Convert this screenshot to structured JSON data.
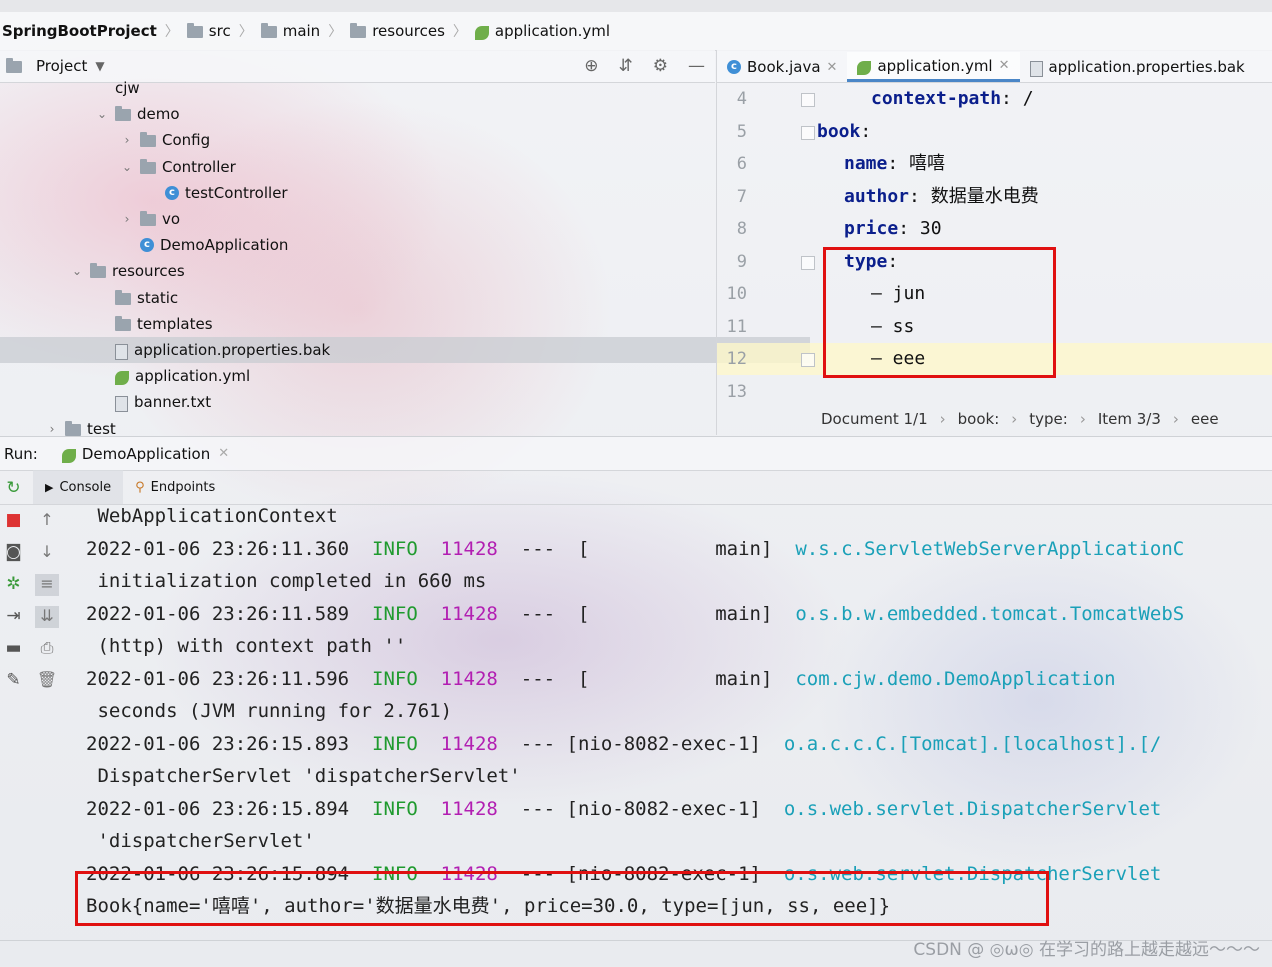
{
  "breadcrumb": {
    "project": "SpringBootProject",
    "items": [
      "src",
      "main",
      "resources",
      "application.yml"
    ]
  },
  "project_panel": {
    "title": "Project",
    "tree": [
      {
        "label": "cjw",
        "indent": 1,
        "icon": "none"
      },
      {
        "label": "demo",
        "indent": 1,
        "icon": "folder",
        "arrow": "down"
      },
      {
        "label": "Config",
        "indent": 2,
        "icon": "folder",
        "arrow": "right"
      },
      {
        "label": "Controller",
        "indent": 2,
        "icon": "folder",
        "arrow": "down"
      },
      {
        "label": "testController",
        "indent": 3,
        "icon": "class"
      },
      {
        "label": "vo",
        "indent": 2,
        "icon": "folder",
        "arrow": "right"
      },
      {
        "label": "DemoApplication",
        "indent": 2,
        "icon": "class"
      },
      {
        "label": "resources",
        "indent": 0,
        "icon": "folder",
        "arrow": "down"
      },
      {
        "label": "static",
        "indent": 1,
        "icon": "folder"
      },
      {
        "label": "templates",
        "indent": 1,
        "icon": "folder"
      },
      {
        "label": "application.properties.bak",
        "indent": 1,
        "icon": "file",
        "selected": true
      },
      {
        "label": "application.yml",
        "indent": 1,
        "icon": "leaf"
      },
      {
        "label": "banner.txt",
        "indent": 1,
        "icon": "file"
      },
      {
        "label": "test",
        "indent": -1,
        "icon": "folder",
        "arrow": "right"
      }
    ]
  },
  "editor": {
    "tabs": [
      {
        "label": "Book.java",
        "icon": "class"
      },
      {
        "label": "application.yml",
        "icon": "leaf",
        "active": true
      },
      {
        "label": "application.properties.bak",
        "icon": "file"
      }
    ],
    "lines": [
      {
        "num": "4",
        "indent": 2,
        "key": "context-path",
        "value": "/"
      },
      {
        "num": "5",
        "indent": 0,
        "key": "book",
        "value": ""
      },
      {
        "num": "6",
        "indent": 1,
        "key": "name",
        "value": "嘻嘻"
      },
      {
        "num": "7",
        "indent": 1,
        "key": "author",
        "value": "数据量水电费"
      },
      {
        "num": "8",
        "indent": 1,
        "key": "price",
        "value": "30"
      },
      {
        "num": "9",
        "indent": 1,
        "key": "type",
        "value": ""
      },
      {
        "num": "10",
        "indent": 2,
        "key": "",
        "value": "– jun"
      },
      {
        "num": "11",
        "indent": 2,
        "key": "",
        "value": "– ss"
      },
      {
        "num": "12",
        "indent": 2,
        "key": "",
        "value": "– eee"
      },
      {
        "num": "13",
        "indent": 0,
        "key": "",
        "value": ""
      }
    ],
    "status": [
      "Document 1/1",
      "book:",
      "type:",
      "Item 3/3",
      "eee"
    ]
  },
  "run": {
    "label": "Run:",
    "config": "DemoApplication",
    "tabs": [
      "Console",
      "Endpoints"
    ]
  },
  "console_lines": [
    {
      "text": " WebApplicationContext"
    },
    {
      "ts": "2022-01-06 23:26:11.360",
      "level": "INFO",
      "pid": "11428",
      "thread": "---  [           main]",
      "logger": "w.s.c.ServletWebServerApplicationC"
    },
    {
      "text": " initialization completed in 660 ms"
    },
    {
      "ts": "2022-01-06 23:26:11.589",
      "level": "INFO",
      "pid": "11428",
      "thread": "---  [           main]",
      "logger": "o.s.b.w.embedded.tomcat.TomcatWebS"
    },
    {
      "text": " (http) with context path ''"
    },
    {
      "ts": "2022-01-06 23:26:11.596",
      "level": "INFO",
      "pid": "11428",
      "thread": "---  [           main]",
      "logger": "com.cjw.demo.DemoApplication"
    },
    {
      "text": " seconds (JVM running for 2.761)"
    },
    {
      "ts": "2022-01-06 23:26:15.893",
      "level": "INFO",
      "pid": "11428",
      "thread": "--- [nio-8082-exec-1]",
      "logger": "o.a.c.c.C.[Tomcat].[localhost].[/"
    },
    {
      "text": " DispatcherServlet 'dispatcherServlet'"
    },
    {
      "ts": "2022-01-06 23:26:15.894",
      "level": "INFO",
      "pid": "11428",
      "thread": "--- [nio-8082-exec-1]",
      "logger": "o.s.web.servlet.DispatcherServlet"
    },
    {
      "text": " 'dispatcherServlet'"
    },
    {
      "ts": "2022-01-06 23:26:15.894",
      "level": "INFO",
      "pid": "11428",
      "thread": "--- [nio-8082-exec-1]",
      "logger": "o.s.web.servlet.DispatcherServlet"
    },
    {
      "text": "Book{name='嘻嘻', author='数据量水电费', price=30.0, type=[jun, ss, eee]}"
    }
  ],
  "watermark": "CSDN @ ◎ω◎ 在学习的路上越走越远～～～",
  "colors": {
    "highlight_box": "#e01010",
    "info": "#1f9a2e",
    "pid": "#b21fb2",
    "logger": "#1aa0b8",
    "yaml_key": "#0b1f8c"
  }
}
